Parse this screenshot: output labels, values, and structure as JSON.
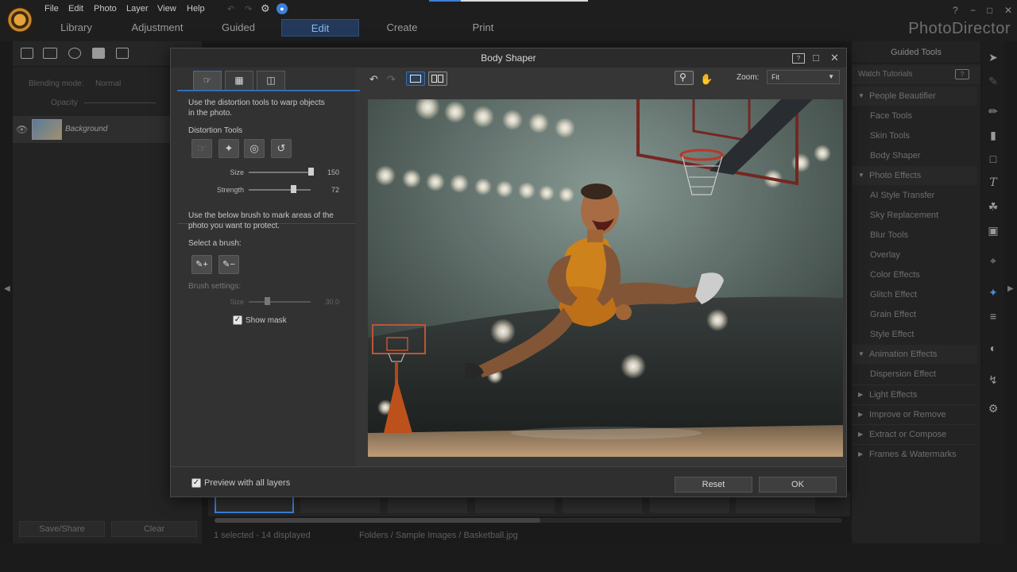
{
  "app": {
    "name": "PhotoDirector",
    "menu": [
      "File",
      "Edit",
      "Photo",
      "Layer",
      "View",
      "Help"
    ],
    "modes": [
      "Library",
      "Adjustment",
      "Guided",
      "Edit",
      "Create",
      "Print"
    ],
    "active_mode": "Edit",
    "window_controls": [
      "?",
      "−",
      "□",
      "✕"
    ]
  },
  "left_panel": {
    "blending_mode_label": "Blending mode:",
    "blending_mode_value": "Normal",
    "opacity_label": "Opacity",
    "layer_name": "Background",
    "save_share_label": "Save/Share",
    "clear_label": "Clear"
  },
  "right_panel": {
    "header": "Guided Tools",
    "watch_tutorials": "Watch Tutorials",
    "sections": [
      {
        "label": "People Beautifier",
        "items": [
          "Face Tools",
          "Skin Tools",
          "Body Shaper"
        ]
      },
      {
        "label": "Photo Effects",
        "items": [
          "AI Style Transfer",
          "Sky Replacement",
          "Blur Tools",
          "Overlay",
          "Color Effects",
          "Glitch Effect",
          "Grain Effect",
          "Style Effect"
        ]
      },
      {
        "label": "Animation Effects",
        "items": [
          "Dispersion Effect"
        ]
      },
      {
        "label": "Light Effects",
        "items": []
      },
      {
        "label": "Improve or Remove",
        "items": []
      },
      {
        "label": "Extract or Compose",
        "items": []
      },
      {
        "label": "Frames & Watermarks",
        "items": []
      }
    ]
  },
  "status": {
    "selection": "1 selected - 14 displayed",
    "path": "Folders / Sample Images / Basketball.jpg"
  },
  "dialog": {
    "title": "Body Shaper",
    "intro_text_1": "Use the distortion tools to warp objects",
    "intro_text_2": "in the photo.",
    "distortion_tools_label": "Distortion Tools",
    "size_label": "Size",
    "size_value": "150",
    "size_level": 1.0,
    "strength_label": "Strength",
    "strength_value": "72",
    "strength_level": 0.72,
    "protect_text_1": "Use the below brush to mark areas of the",
    "protect_text_2": "photo you want to protect.",
    "select_brush_label": "Select a brush:",
    "brush_settings_label": "Brush settings:",
    "brush_size_label": "Size",
    "brush_size_value": "30.0",
    "brush_size_level": 0.3,
    "show_mask_label": "Show mask",
    "show_mask_checked": true,
    "zoom_label": "Zoom:",
    "zoom_value": "Fit",
    "preview_label": "Preview with all layers",
    "preview_checked": true,
    "reset_label": "Reset",
    "ok_label": "OK"
  },
  "colors": {
    "accent": "#2e6fb8",
    "jersey": "#d98a1e",
    "background": "#1a1a1a"
  }
}
